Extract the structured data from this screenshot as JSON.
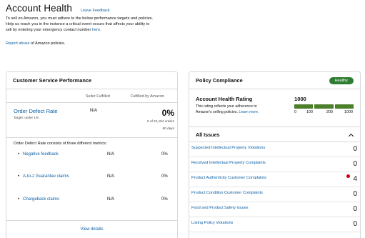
{
  "header": {
    "title": "Account Health",
    "leave_feedback": "Leave Feedback",
    "intro_line1": "To sell on Amazon, you must adhere to the below performance targets and policies.",
    "intro_line2": "Help us reach you in the instance a critical event occurs that affects your ability to",
    "intro_line3_prefix": "sell by entering your emergency contact number ",
    "intro_link": "here",
    "intro_line3_suffix": ".",
    "report_link": "Report abuse",
    "report_suffix": " of Amazon policies."
  },
  "csp": {
    "title": "Customer Service Performance",
    "col_seller": "Seller Fulfilled",
    "col_fba": "Fulfilled by Amazon",
    "odr": {
      "label": "Order Defect Rate",
      "target": "Target: under 1%",
      "seller_value": "N/A",
      "fba_value": "0%",
      "fba_orders": "0 of 22,184 orders",
      "fba_days": "60 days"
    },
    "consists_text": "Order Defect Rate consists of three different metrics:",
    "metrics": [
      {
        "bullet": "•",
        "name": "Negative feedback",
        "seller": "N/A",
        "fba": "0%"
      },
      {
        "bullet": "•",
        "name": "A-to-z Guarantee claims",
        "seller": "N/A",
        "fba": "0%"
      },
      {
        "bullet": "•",
        "name": "Chargeback claims",
        "seller": "N/A",
        "fba": "0%"
      }
    ],
    "view_details": "View details"
  },
  "pc": {
    "title": "Policy Compliance",
    "badge": "Healthy",
    "ahr": {
      "title": "Account Health Rating",
      "desc_line1": "This rating reflects your adherence to",
      "desc_line2_prefix": "Amazon's selling policies. ",
      "learn_more": "Learn more.",
      "score": "1000",
      "ticks": [
        "0",
        "100",
        "200",
        "1000"
      ]
    },
    "all_issues": "All Issues",
    "issues": [
      {
        "name": "Suspected Intellectual Property Violations",
        "count": "0",
        "alert": false
      },
      {
        "name": "Received Intellectual Property Complaints",
        "count": "0",
        "alert": false
      },
      {
        "name": "Product Authenticity Customer Complaints",
        "count": "4",
        "alert": true
      },
      {
        "name": "Product Condition Customer Complaints",
        "count": "0",
        "alert": false
      },
      {
        "name": "Food and Product Safety Issues",
        "count": "0",
        "alert": false
      },
      {
        "name": "Listing Policy Violations",
        "count": "0",
        "alert": false
      }
    ]
  },
  "colors": {
    "link": "#0b5fa5",
    "healthy_badge": "#2e7d32",
    "rating_bar": "#4b7f2a",
    "alert": "#c40000"
  }
}
